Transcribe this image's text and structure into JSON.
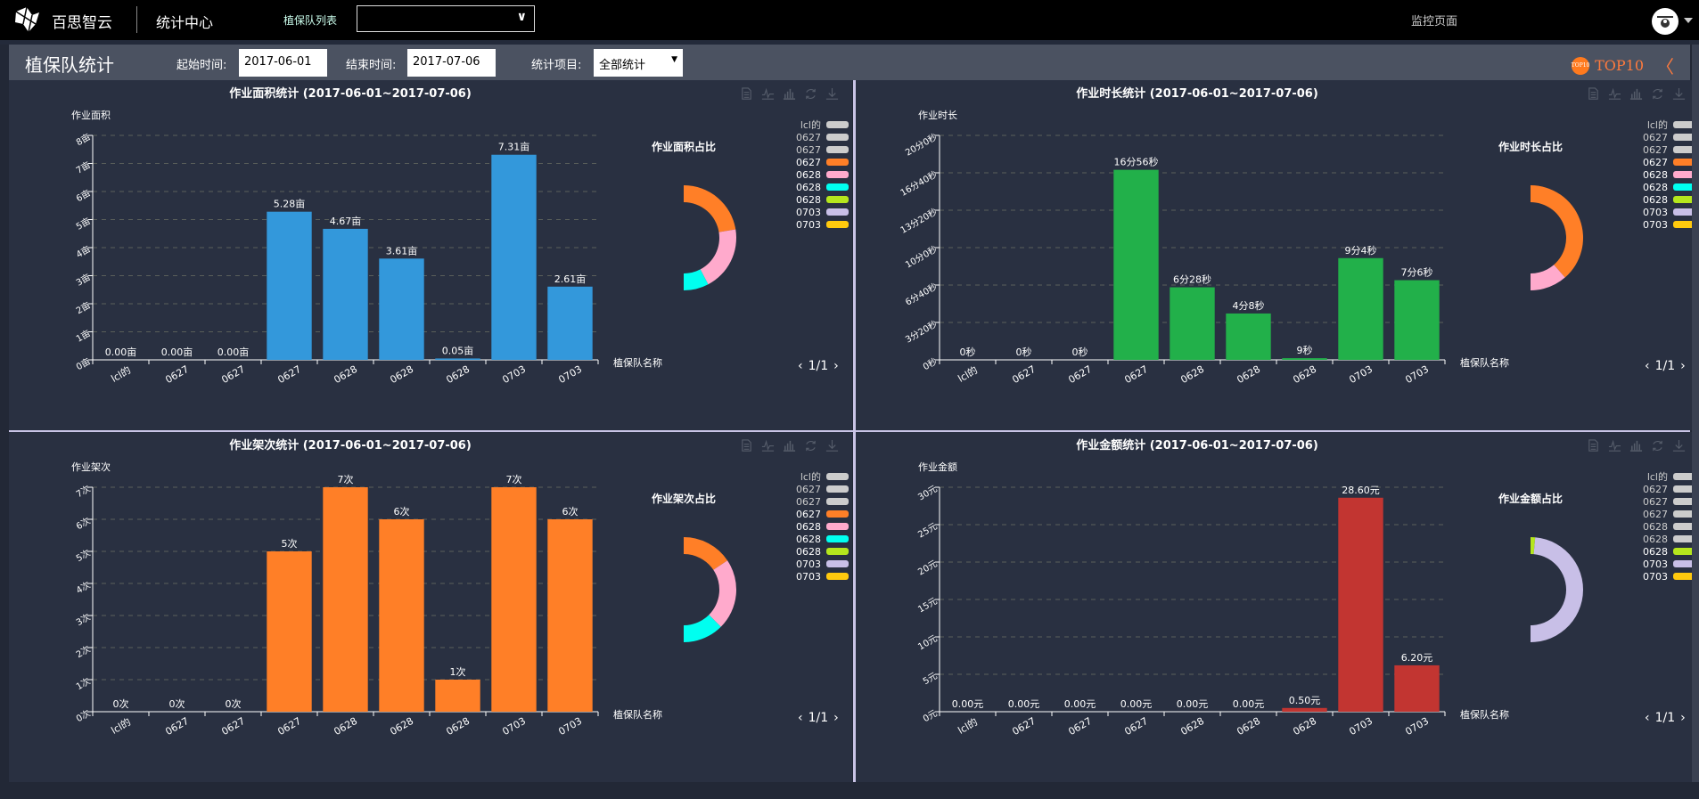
{
  "topbar": {
    "brand": "百思智云",
    "section": "统计中心",
    "team_list_label": "植保队列表",
    "team_select_value": "",
    "monitor_link": "监控页面"
  },
  "header": {
    "title": "植保队统计",
    "start_label": "起始时间:",
    "start_value": "2017-06-01",
    "end_label": "结束时间:",
    "end_value": "2017-07-06",
    "item_label": "统计项目:",
    "item_value": "全部统计",
    "top10_label": "TOP10",
    "top10_icon_text": "TOP10"
  },
  "chart_data": [
    {
      "type": "bar",
      "title": "作业面积统计 (2017-06-01~2017-07-06)",
      "ylabel": "作业面积",
      "xlabel": "植保队名称",
      "pie_title": "作业面积占比",
      "pager": "1/1",
      "categories": [
        "lcl的",
        "0627",
        "0627",
        "0627",
        "0628",
        "0628",
        "0628",
        "0703",
        "0703"
      ],
      "values": [
        0,
        0,
        0,
        5.28,
        4.67,
        3.61,
        0.05,
        7.31,
        2.61
      ],
      "value_labels": [
        "0.00亩",
        "0.00亩",
        "0.00亩",
        "5.28亩",
        "4.67亩",
        "3.61亩",
        "0.05亩",
        "7.31亩",
        "2.61亩"
      ],
      "y_ticks": [
        0,
        1,
        2,
        3,
        4,
        5,
        6,
        7,
        8
      ],
      "y_tick_labels": [
        "0亩",
        "1亩",
        "2亩",
        "3亩",
        "4亩",
        "5亩",
        "6亩",
        "7亩",
        "8亩"
      ],
      "ylim": [
        0,
        8
      ],
      "grid": true,
      "bar_color": "#3398db",
      "legend": [
        {
          "name": "lcl的",
          "color": "#cccccc",
          "active": false
        },
        {
          "name": "0627",
          "color": "#cccccc",
          "active": false
        },
        {
          "name": "0627",
          "color": "#cccccc",
          "active": false
        },
        {
          "name": "0627",
          "color": "#ff7f27",
          "active": true
        },
        {
          "name": "0628",
          "color": "#ffaacc",
          "active": true
        },
        {
          "name": "0628",
          "color": "#00fff0",
          "active": true
        },
        {
          "name": "0628",
          "color": "#b5e61d",
          "active": true
        },
        {
          "name": "0703",
          "color": "#c8bfe7",
          "active": true
        },
        {
          "name": "0703",
          "color": "#ffc90e",
          "active": true
        }
      ]
    },
    {
      "type": "bar",
      "title": "作业时长统计 (2017-06-01~2017-07-06)",
      "ylabel": "作业时长",
      "xlabel": "植保队名称",
      "pie_title": "作业时长占比",
      "pager": "1/1",
      "categories": [
        "lcl的",
        "0627",
        "0627",
        "0627",
        "0628",
        "0628",
        "0628",
        "0703",
        "0703"
      ],
      "values": [
        0,
        0,
        0,
        1016,
        388,
        248,
        9,
        544,
        426
      ],
      "value_labels": [
        "0秒",
        "0秒",
        "0秒",
        "16分56秒",
        "6分28秒",
        "4分8秒",
        "9秒",
        "9分4秒",
        "7分6秒"
      ],
      "y_ticks": [
        0,
        200,
        400,
        600,
        800,
        1000,
        1200
      ],
      "y_tick_labels": [
        "0秒",
        "3分20秒",
        "6分40秒",
        "10分0秒",
        "13分20秒",
        "16分40秒",
        "20分0秒"
      ],
      "ylim": [
        0,
        1200
      ],
      "grid": true,
      "bar_color": "#22b04a",
      "legend": [
        {
          "name": "lcl的",
          "color": "#cccccc",
          "active": false
        },
        {
          "name": "0627",
          "color": "#cccccc",
          "active": false
        },
        {
          "name": "0627",
          "color": "#cccccc",
          "active": false
        },
        {
          "name": "0627",
          "color": "#ff7f27",
          "active": true
        },
        {
          "name": "0628",
          "color": "#ffaacc",
          "active": true
        },
        {
          "name": "0628",
          "color": "#00fff0",
          "active": true
        },
        {
          "name": "0628",
          "color": "#b5e61d",
          "active": true
        },
        {
          "name": "0703",
          "color": "#c8bfe7",
          "active": true
        },
        {
          "name": "0703",
          "color": "#ffc90e",
          "active": true
        }
      ]
    },
    {
      "type": "bar",
      "title": "作业架次统计 (2017-06-01~2017-07-06)",
      "ylabel": "作业架次",
      "xlabel": "植保队名称",
      "pie_title": "作业架次占比",
      "pager": "1/1",
      "categories": [
        "lcl的",
        "0627",
        "0627",
        "0627",
        "0628",
        "0628",
        "0628",
        "0703",
        "0703"
      ],
      "values": [
        0,
        0,
        0,
        5,
        7,
        6,
        1,
        7,
        6
      ],
      "value_labels": [
        "0次",
        "0次",
        "0次",
        "5次",
        "7次",
        "6次",
        "1次",
        "7次",
        "6次"
      ],
      "y_ticks": [
        0,
        1,
        2,
        3,
        4,
        5,
        6,
        7
      ],
      "y_tick_labels": [
        "0次",
        "1次",
        "2次",
        "3次",
        "4次",
        "5次",
        "6次",
        "7次"
      ],
      "ylim": [
        0,
        7
      ],
      "grid": true,
      "bar_color": "#ff7f27",
      "legend": [
        {
          "name": "lcl的",
          "color": "#cccccc",
          "active": false
        },
        {
          "name": "0627",
          "color": "#cccccc",
          "active": false
        },
        {
          "name": "0627",
          "color": "#cccccc",
          "active": false
        },
        {
          "name": "0627",
          "color": "#ff7f27",
          "active": true
        },
        {
          "name": "0628",
          "color": "#ffaacc",
          "active": true
        },
        {
          "name": "0628",
          "color": "#00fff0",
          "active": true
        },
        {
          "name": "0628",
          "color": "#b5e61d",
          "active": true
        },
        {
          "name": "0703",
          "color": "#c8bfe7",
          "active": true
        },
        {
          "name": "0703",
          "color": "#ffc90e",
          "active": true
        }
      ]
    },
    {
      "type": "bar",
      "title": "作业金额统计 (2017-06-01~2017-07-06)",
      "ylabel": "作业金额",
      "xlabel": "植保队名称",
      "pie_title": "作业金额占比",
      "pager": "1/1",
      "categories": [
        "lcl的",
        "0627",
        "0627",
        "0627",
        "0628",
        "0628",
        "0628",
        "0703",
        "0703"
      ],
      "values": [
        0,
        0,
        0,
        0,
        0,
        0,
        0.5,
        28.6,
        6.2
      ],
      "value_labels": [
        "0.00元",
        "0.00元",
        "0.00元",
        "0.00元",
        "0.00元",
        "0.00元",
        "0.50元",
        "28.60元",
        "6.20元"
      ],
      "y_ticks": [
        0,
        5,
        10,
        15,
        20,
        25,
        30
      ],
      "y_tick_labels": [
        "0元",
        "5元",
        "10元",
        "15元",
        "20元",
        "25元",
        "30元"
      ],
      "ylim": [
        0,
        30
      ],
      "grid": true,
      "bar_color": "#c23531",
      "legend": [
        {
          "name": "lcl的",
          "color": "#cccccc",
          "active": false
        },
        {
          "name": "0627",
          "color": "#cccccc",
          "active": false
        },
        {
          "name": "0627",
          "color": "#cccccc",
          "active": false
        },
        {
          "name": "0627",
          "color": "#cccccc",
          "active": false
        },
        {
          "name": "0628",
          "color": "#cccccc",
          "active": false
        },
        {
          "name": "0628",
          "color": "#cccccc",
          "active": false
        },
        {
          "name": "0628",
          "color": "#b5e61d",
          "active": true
        },
        {
          "name": "0703",
          "color": "#c8bfe7",
          "active": true
        },
        {
          "name": "0703",
          "color": "#ffc90e",
          "active": true
        }
      ]
    }
  ],
  "toolbar_icons": [
    "data-view-icon",
    "line-chart-icon",
    "bar-chart-icon",
    "restore-icon",
    "download-icon"
  ]
}
